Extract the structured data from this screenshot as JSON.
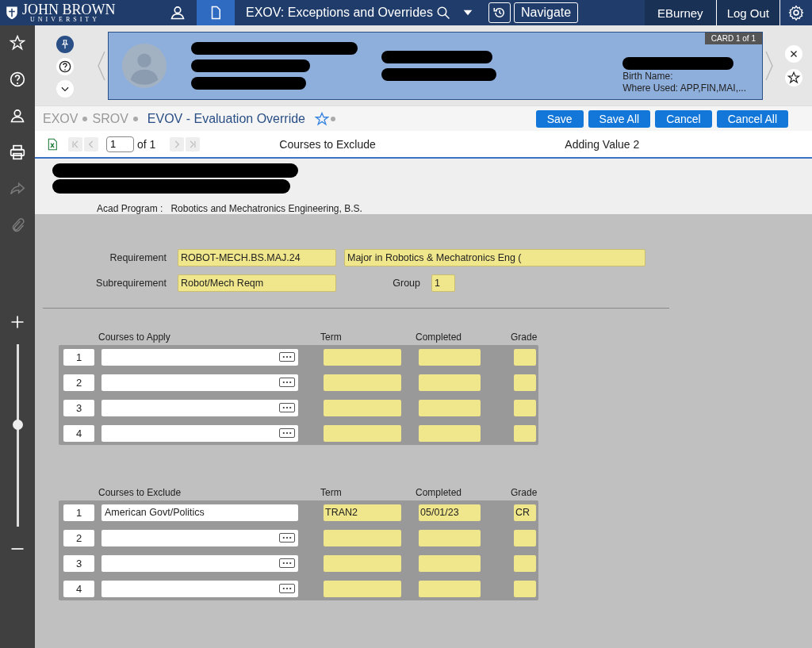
{
  "topbar": {
    "logo_line1": "JOHN BROWN",
    "logo_line2": "UNIVERSITY",
    "nav_icons": [
      {
        "kind": "person",
        "selected": false
      },
      {
        "kind": "document",
        "selected": true
      }
    ],
    "form_title": "EXOV: Exceptions and Overrides",
    "navigate": "Navigate",
    "user": "EBurney",
    "logout": "Log Out"
  },
  "sidebar": {
    "icons": [
      {
        "kind": "star",
        "disabled": false
      },
      {
        "kind": "help",
        "disabled": false
      },
      {
        "kind": "person",
        "disabled": false
      },
      {
        "kind": "print",
        "disabled": false
      },
      {
        "kind": "share",
        "disabled": true
      },
      {
        "kind": "attach",
        "disabled": true
      }
    ],
    "zoom": {
      "level": 0.56
    }
  },
  "card": {
    "badge": "CARD 1 of 1",
    "columns": [
      [
        {
          "kind": "redacted"
        },
        {
          "kind": "redacted"
        },
        {
          "kind": "redacted"
        }
      ],
      [
        {
          "kind": "redacted"
        },
        {
          "kind": "redacted"
        }
      ],
      [
        {
          "kind": "redacted"
        },
        {
          "kind": "text",
          "text": "Birth Name:"
        },
        {
          "kind": "text",
          "text": "Where Used: APP,FIN,MAI,..."
        }
      ]
    ]
  },
  "breadcrumb": [
    {
      "label": "EXOV",
      "current": false
    },
    {
      "label": "SROV",
      "current": false
    },
    {
      "label": "EVOV - Evaluation Override",
      "current": true
    }
  ],
  "actions": [
    "Save",
    "Save All",
    "Cancel",
    "Cancel All"
  ],
  "toolbar": {
    "page": "1",
    "of": "of 1",
    "block_title": "Courses to Exclude",
    "status": "Adding Value 2"
  },
  "info": {
    "redactions": [
      {
        "kind": "redacted"
      },
      {
        "kind": "redacted"
      }
    ],
    "program_label": "Acad Program :",
    "program_value": "Robotics and Mechatronics Engineering, B.S."
  },
  "requirement": {
    "label": "Requirement",
    "value": "ROBOT-MECH.BS.MAJ.24",
    "description": "Major in Robotics & Mechatronics Eng (",
    "sub_label": "Subrequirement",
    "sub_value": "Robot/Mech Reqm",
    "group_label": "Group",
    "group_value": "1"
  },
  "tables": [
    {
      "columns": [
        "Courses to Apply",
        "Term",
        "Completed",
        "Grade"
      ],
      "rows": [
        {
          "number": "1",
          "course": "",
          "has_lookup": true,
          "term": "",
          "completed": "",
          "grade": ""
        },
        {
          "number": "2",
          "course": "",
          "has_lookup": true,
          "term": "",
          "completed": "",
          "grade": ""
        },
        {
          "number": "3",
          "course": "",
          "has_lookup": true,
          "term": "",
          "completed": "",
          "grade": ""
        },
        {
          "number": "4",
          "course": "",
          "has_lookup": true,
          "term": "",
          "completed": "",
          "grade": ""
        }
      ]
    },
    {
      "columns": [
        "Courses to Exclude",
        "Term",
        "Completed",
        "Grade"
      ],
      "rows": [
        {
          "number": "1",
          "course": "American Govt/Politics",
          "has_lookup": false,
          "term": "TRAN2",
          "completed": "05/01/23",
          "grade": "CR"
        },
        {
          "number": "2",
          "course": "",
          "has_lookup": true,
          "term": "",
          "completed": "",
          "grade": ""
        },
        {
          "number": "3",
          "course": "",
          "has_lookup": true,
          "term": "",
          "completed": "",
          "grade": ""
        },
        {
          "number": "4",
          "course": "",
          "has_lookup": true,
          "term": "",
          "completed": "",
          "grade": ""
        }
      ]
    }
  ]
}
